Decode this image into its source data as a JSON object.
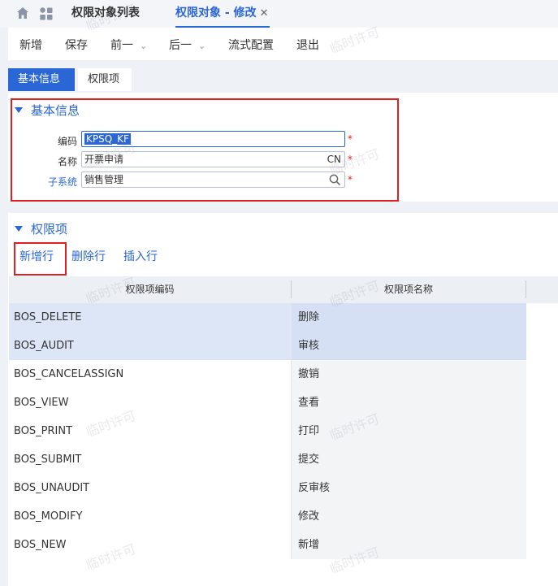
{
  "topbar": {
    "list_tab": "权限对象列表",
    "edit_tab": "权限对象 - 修改",
    "close": "✕"
  },
  "toolbar": {
    "new": "新增",
    "save": "保存",
    "prev": "前一",
    "next": "后一",
    "flow": "流式配置",
    "exit": "退出"
  },
  "subtabs": {
    "basic": "基本信息",
    "perm": "权限项"
  },
  "basic": {
    "title": "基本信息",
    "code_label": "编码",
    "code_value": "KPSQ_KF",
    "name_label": "名称",
    "name_value": "开票申请",
    "name_lang": "CN",
    "subsystem_label": "子系统",
    "subsystem_value": "销售管理",
    "required": "*"
  },
  "perm": {
    "title": "权限项",
    "add_row": "新增行",
    "delete_row": "删除行",
    "insert_row": "插入行",
    "col_code": "权限项编码",
    "col_name": "权限项名称",
    "rows": [
      {
        "code": "BOS_DELETE",
        "name": "删除"
      },
      {
        "code": "BOS_AUDIT",
        "name": "审核"
      },
      {
        "code": "BOS_CANCELASSIGN",
        "name": "撤销"
      },
      {
        "code": "BOS_VIEW",
        "name": "查看"
      },
      {
        "code": "BOS_PRINT",
        "name": "打印"
      },
      {
        "code": "BOS_SUBMIT",
        "name": "提交"
      },
      {
        "code": "BOS_UNAUDIT",
        "name": "反审核"
      },
      {
        "code": "BOS_MODIFY",
        "name": "修改"
      },
      {
        "code": "BOS_NEW",
        "name": "新增"
      }
    ]
  },
  "watermark": "临时许可",
  "colors": {
    "accent": "#2b66d6",
    "highlight": "#e02020"
  }
}
